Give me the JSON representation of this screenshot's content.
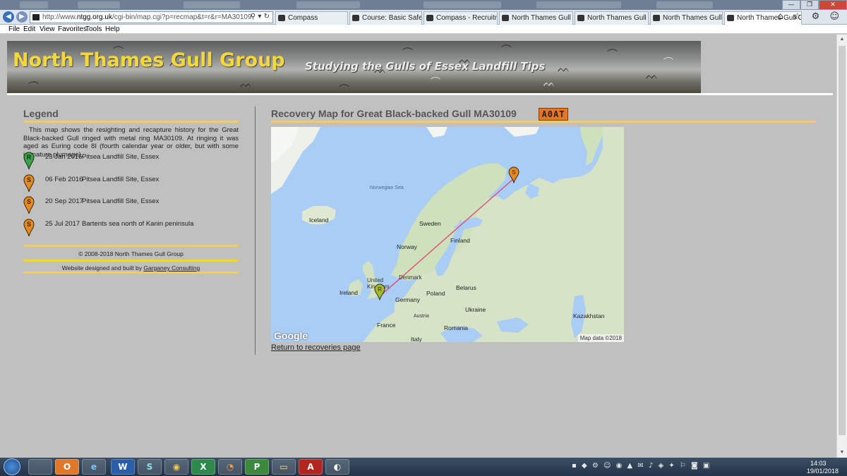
{
  "browser": {
    "url_prefix": "http://www.",
    "url_domain": "ntgg.org.uk",
    "url_rest": "/cgi-bin/map.cgi?p=recmap&t=r&r=MA30109",
    "address_icons": "⚲ ▾ ↻",
    "tabs": [
      {
        "label": "Compass",
        "active": false
      },
      {
        "label": "Course: Basic Safeguardi...",
        "active": false
      },
      {
        "label": "Compass - Recruitment ...",
        "active": false
      },
      {
        "label": "North Thames Gull Grou...",
        "active": false
      },
      {
        "label": "North Thames Gull Grou...",
        "active": false
      },
      {
        "label": "North Thames Gull Grou...",
        "active": false
      },
      {
        "label": "North Thames Gull Gr...",
        "active": true
      }
    ],
    "tab_close": "✕",
    "tool_icons": "⌂ ☆ ⚙ ☺",
    "window_controls": {
      "minimize": "—",
      "restore": "❐",
      "close": "✕"
    },
    "menu": [
      "File",
      "Edit",
      "View",
      "Favorites",
      "Tools",
      "Help"
    ]
  },
  "site": {
    "title": "North Thames Gull Group",
    "tagline": "Studying the Gulls of Essex Landfill Tips"
  },
  "legend": {
    "heading": "Legend",
    "description": "This map shows the resighting and recapture history for the Great Black-backed Gull ringed with metal ring MA30109. At ringing it was aged as Euring code 8I (fourth calendar year or older, but with some immature plumage).",
    "entries": [
      {
        "type": "R",
        "date": "23 Jan 2016",
        "place": "Pitsea Landfill Site, Essex",
        "color": "#3aa34a"
      },
      {
        "type": "S",
        "date": "06 Feb 2016",
        "place": "Pitsea Landfill Site, Essex",
        "color": "#e58a1e"
      },
      {
        "type": "S",
        "date": "20 Sep 2017",
        "place": "Pitsea Landfill Site, Essex",
        "color": "#e58a1e"
      },
      {
        "type": "S",
        "date": "25 Jul 2017",
        "place": "Bartents sea north of Kanin peninsula",
        "color": "#e58a1e"
      }
    ],
    "copyright": "© 2008-2018 North Thames Gull Group",
    "credit_prefix": "Website designed and built by ",
    "credit_link": "Garganey Consulting"
  },
  "main": {
    "heading": "Recovery Map for Great Black-backed Gull MA30109",
    "ring_code": "A0AT",
    "return_link": "Return to recoveries page"
  },
  "map": {
    "labels": {
      "norwegian_sea": "Norwegian Sea",
      "iceland": "Iceland",
      "sweden": "Sweden",
      "finland": "Finland",
      "norway": "Norway",
      "denmark": "Denmark",
      "united_kingdom": "United Kingdom",
      "ireland": "Ireland",
      "poland": "Poland",
      "belarus": "Belarus",
      "germany": "Germany",
      "ukraine": "Ukraine",
      "austria": "Austria",
      "france": "France",
      "romania": "Romania",
      "italy": "Italy",
      "kazakhstan": "Kazakhstan"
    },
    "logo": "Google",
    "attribution": "Map data ©2018",
    "marker_r": "R",
    "marker_s": "S"
  },
  "taskbar": {
    "apps": [
      "",
      "O",
      "e",
      "W",
      "S",
      "◉",
      "X",
      "◔",
      "P",
      "▭",
      "A",
      "◐"
    ],
    "tray": "▪ ◆ ⚙ ☺ ◉ ▲ ✉ ♪ ◈ ✦ ⚐ ◙ ▣",
    "time": "14:03",
    "date": "19/01/2018"
  },
  "colors": {
    "accent_yellow": "#f3d33d",
    "page_bg": "#c0c0c0",
    "ring_badge": "#e8751f",
    "route_line": "#e0466c"
  }
}
